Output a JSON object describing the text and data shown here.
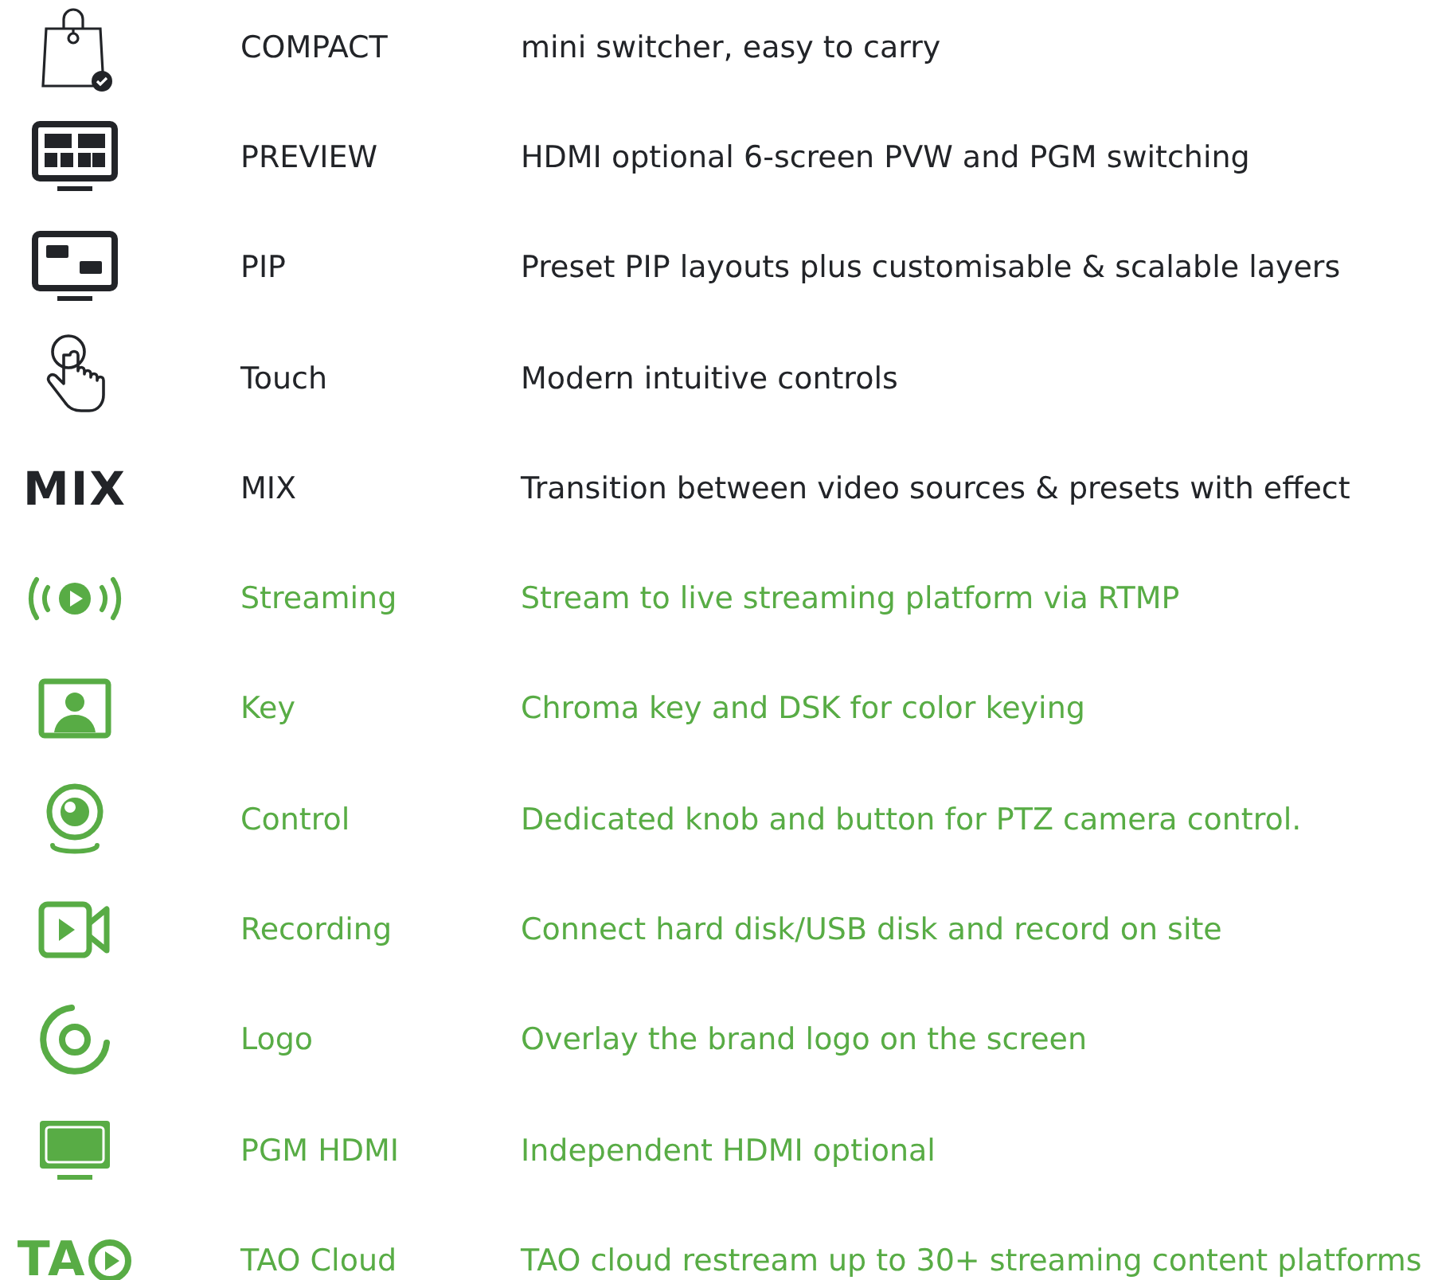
{
  "features": [
    {
      "kind": "bag",
      "color": "#222428",
      "title": "COMPACT",
      "description": "mini switcher, easy to carry"
    },
    {
      "kind": "multiview",
      "color": "#222428",
      "title": "PREVIEW",
      "description": "HDMI optional 6-screen PVW and PGM switching"
    },
    {
      "kind": "pip",
      "color": "#222428",
      "title": "PIP",
      "description": "Preset PIP layouts plus customisable & scalable layers"
    },
    {
      "kind": "touch",
      "color": "#222428",
      "title": "Touch",
      "description": "Modern intuitive controls"
    },
    {
      "kind": "wordmark",
      "color": "#222428",
      "icon_text": "MIX",
      "title": "MIX",
      "description": "Transition between video sources & presets with effect"
    },
    {
      "kind": "broadcast",
      "color": "#58ac45",
      "title": "Streaming",
      "description": "Stream to live streaming platform via RTMP"
    },
    {
      "kind": "portrait",
      "color": "#58ac45",
      "title": "Key",
      "description": "Chroma key and DSK for color keying"
    },
    {
      "kind": "webcam",
      "color": "#58ac45",
      "title": "Control",
      "description": "Dedicated knob and button for PTZ camera control."
    },
    {
      "kind": "camera",
      "color": "#58ac45",
      "title": "Recording",
      "description": "Connect hard disk/USB disk and record on site"
    },
    {
      "kind": "ring",
      "color": "#58ac45",
      "title": "Logo",
      "description": "Overlay the brand logo on the screen"
    },
    {
      "kind": "monitor",
      "color": "#58ac45",
      "title": "PGM HDMI",
      "description": "Independent HDMI optional"
    },
    {
      "kind": "logo",
      "color": "#58ac45",
      "icon_text": "TA",
      "title": "TAO Cloud",
      "description": "TAO cloud restream up to 30+ streaming content platforms"
    }
  ]
}
